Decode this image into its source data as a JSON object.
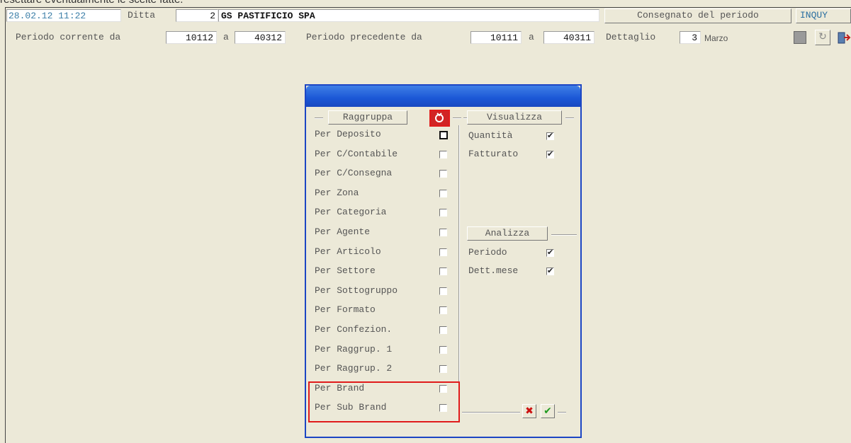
{
  "caption": "resettare eventualmente le scelte fatte.",
  "header": {
    "datetime": "28.02.12 11:22",
    "ditta_label": "Ditta",
    "ditta_code": "2",
    "ditta_name": "GS PASTIFICIO SPA",
    "consegnato_button": "Consegnato del periodo",
    "inquiry_button": "INQUY",
    "periodo_corrente_label": "Periodo corrente da",
    "periodo_corrente_da": "10112",
    "a_label": "a",
    "periodo_corrente_a": "40312",
    "periodo_precedente_label": "Periodo precedente da",
    "periodo_precedente_da": "10111",
    "periodo_precedente_a": "40311",
    "dettaglio_label": "Dettaglio",
    "dettaglio_value": "3",
    "dettaglio_month": "Marzo"
  },
  "dialog": {
    "raggruppa_label": "Raggruppa",
    "visualizza_label": "Visualizza",
    "analizza_label": "Analizza",
    "group_items": [
      {
        "label": "Per Deposito",
        "checked": false
      },
      {
        "label": "Per C/Contabile",
        "checked": false
      },
      {
        "label": "Per C/Consegna",
        "checked": false
      },
      {
        "label": "Per Zona",
        "checked": false
      },
      {
        "label": "Per Categoria",
        "checked": false
      },
      {
        "label": "Per Agente",
        "checked": false
      },
      {
        "label": "Per Articolo",
        "checked": false
      },
      {
        "label": "Per Settore",
        "checked": false
      },
      {
        "label": "Per Sottogruppo",
        "checked": false
      },
      {
        "label": "Per Formato",
        "checked": false
      },
      {
        "label": "Per Confezion.",
        "checked": false
      },
      {
        "label": "Per Raggrup. 1",
        "checked": false
      },
      {
        "label": "Per Raggrup. 2",
        "checked": false
      },
      {
        "label": "Per Brand",
        "checked": false
      },
      {
        "label": "Per Sub Brand",
        "checked": false
      }
    ],
    "visualizza_items": [
      {
        "label": "Quantità",
        "checked": true
      },
      {
        "label": "Fatturato",
        "checked": true
      }
    ],
    "analizza_items": [
      {
        "label": "Periodo",
        "checked": true
      },
      {
        "label": "Dett.mese",
        "checked": true
      }
    ],
    "cancel_icon": "red-x-icon",
    "confirm_icon": "green-check-icon",
    "reset_icon": "reset-icon"
  },
  "colors": {
    "background": "#ece9d8",
    "dialog_border": "#1c46c4",
    "highlight_red": "#e01b1b",
    "datetime_color": "#3d7fa8"
  }
}
